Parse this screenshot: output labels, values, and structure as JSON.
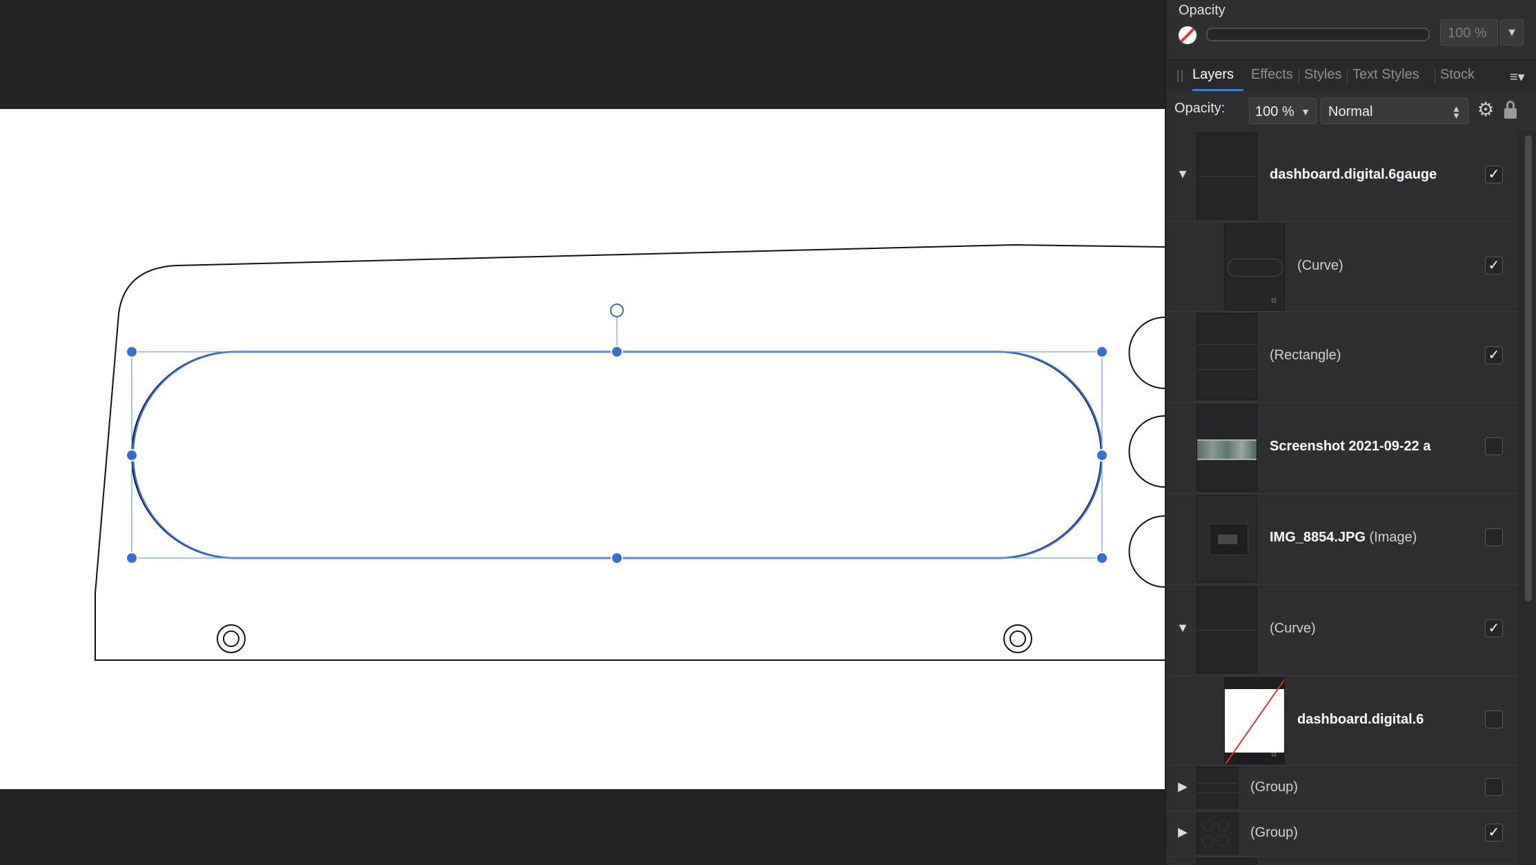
{
  "opacity_panel": {
    "title": "Opacity",
    "value": "100 %",
    "fill_icon": "no-fill-icon"
  },
  "tabs": [
    {
      "label": "Layers",
      "active": true
    },
    {
      "label": "Effects",
      "active": false
    },
    {
      "label": "Styles",
      "active": false
    },
    {
      "label": "Text Styles",
      "active": false
    },
    {
      "label": "Stock",
      "active": false
    }
  ],
  "layer_options": {
    "opacity_label": "Opacity:",
    "opacity_value": "100 %",
    "blend_mode": "Normal",
    "settings_icon": "gear-icon",
    "lock_icon": "lock-icon"
  },
  "layers": [
    {
      "name": "dashboard.digital.6gauge",
      "type": "",
      "bold": true,
      "expanded": true,
      "visible": true,
      "child": false
    },
    {
      "name": "(Curve)",
      "type": "",
      "bold": false,
      "visible": true,
      "child": true
    },
    {
      "name": "(Rectangle)",
      "type": "",
      "bold": false,
      "visible": true,
      "child": false
    },
    {
      "name": "Screenshot 2021-09-22 a",
      "type": "",
      "bold": true,
      "visible": false,
      "child": false
    },
    {
      "name": "IMG_8854.JPG",
      "type": "(Image)",
      "bold": true,
      "visible": false,
      "child": false
    },
    {
      "name": "(Curve)",
      "type": "",
      "bold": false,
      "expanded": true,
      "visible": true,
      "child": false
    },
    {
      "name": "dashboard.digital.6",
      "type": "",
      "bold": true,
      "visible": false,
      "child": true
    },
    {
      "name": "(Group)",
      "type": "",
      "bold": false,
      "expanded": false,
      "visible": false,
      "child": false
    },
    {
      "name": "(Group)",
      "type": "",
      "bold": false,
      "expanded": false,
      "visible": true,
      "child": false
    }
  ],
  "colors": {
    "accent": "#2e7cf6",
    "selection": "#3a6fd0",
    "panel_bg": "#2f2f31",
    "canvas_bg": "#232325",
    "no_fill_red": "#e0352d"
  }
}
